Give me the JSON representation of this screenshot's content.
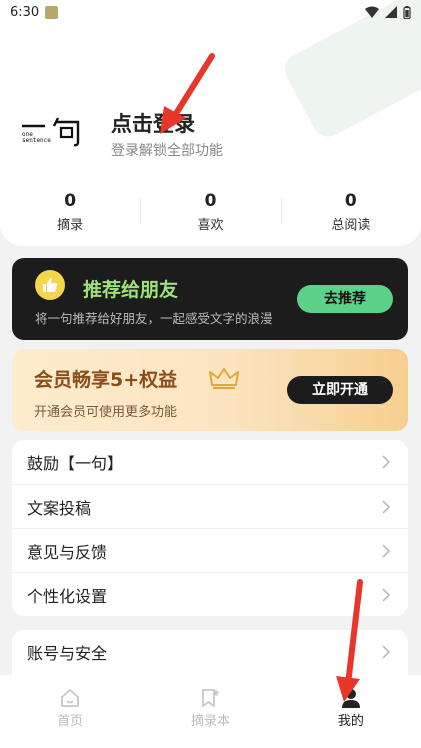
{
  "status_bar": {
    "time": "6:30"
  },
  "profile": {
    "logo_text_main": "一句",
    "logo_text_sub": "one sentence",
    "login_title": "点击登录",
    "login_subtitle": "登录解锁全部功能"
  },
  "stats": [
    {
      "value": "0",
      "label": "摘录"
    },
    {
      "value": "0",
      "label": "喜欢"
    },
    {
      "value": "0",
      "label": "总阅读"
    }
  ],
  "recommend": {
    "title": "推荐给朋友",
    "subtitle": "将一句推荐给好朋友，一起感受文字的浪漫",
    "button": "去推荐"
  },
  "vip": {
    "title": "会员畅享5+权益",
    "subtitle": "开通会员可使用更多功能",
    "button": "立即开通"
  },
  "menu": {
    "items": [
      "鼓励【一句】",
      "文案投稿",
      "意见与反馈",
      "个性化设置"
    ],
    "second_items": [
      "账号与安全"
    ]
  },
  "tabs": [
    {
      "label": "首页",
      "icon": "home-icon"
    },
    {
      "label": "摘录本",
      "icon": "bookmark-star-icon"
    },
    {
      "label": "我的",
      "icon": "person-icon"
    }
  ],
  "colors": {
    "accent_green": "#5cd18a",
    "annotation_red": "#e8372a"
  }
}
